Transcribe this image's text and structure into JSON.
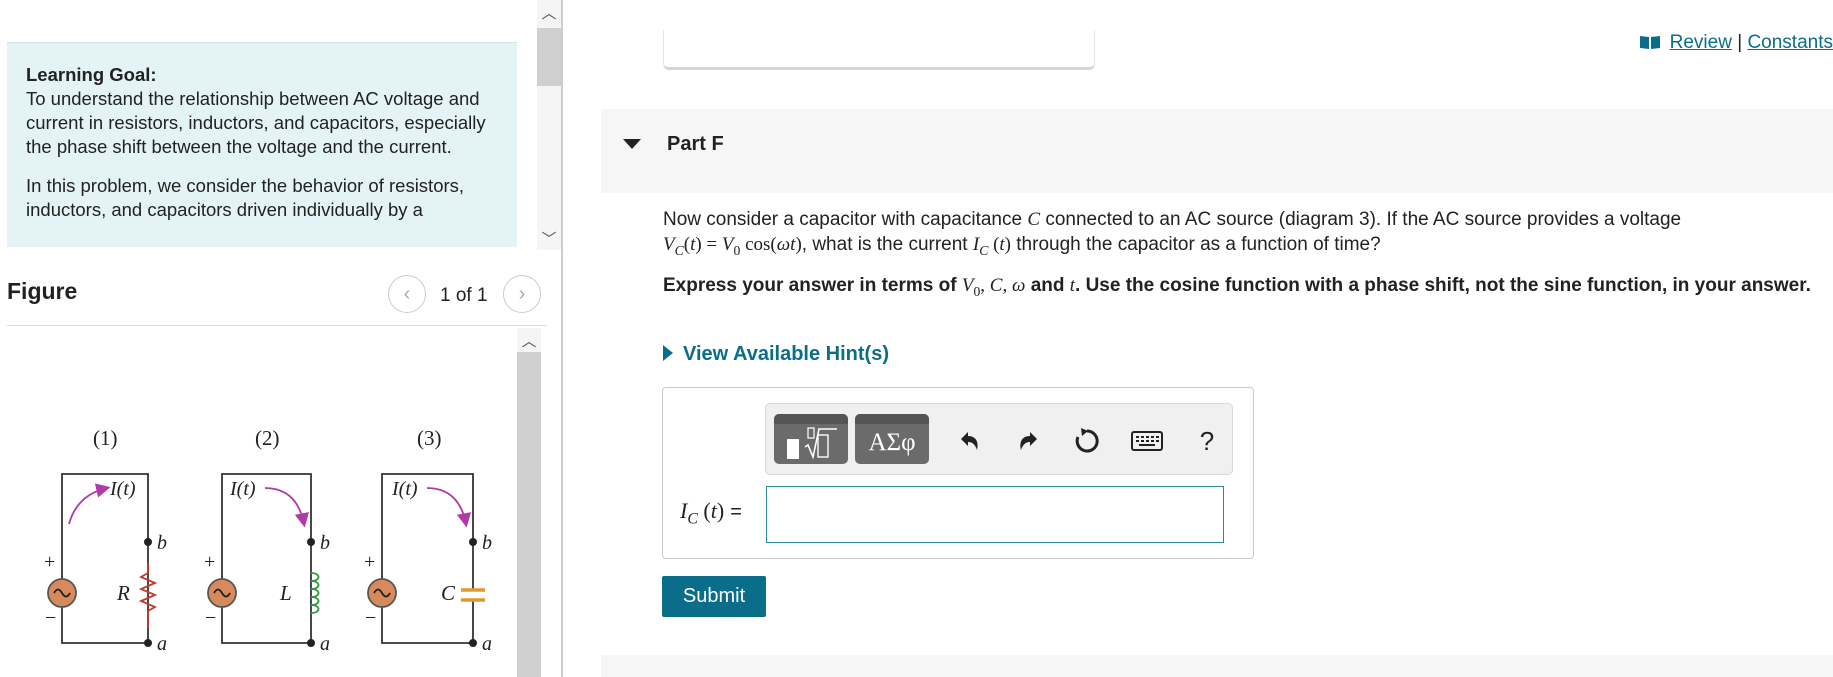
{
  "learning_goal": {
    "title": "Learning Goal:",
    "text": "To understand the relationship between AC voltage and current in resistors, inductors, and capacitors, especially the phase shift between the voltage and the current.",
    "intro": "In this problem, we consider the behavior of resistors, inductors, and capacitors driven individually by a"
  },
  "figure": {
    "title": "Figure",
    "page_indicator": "1 of 1",
    "circuits": [
      {
        "number": "(1)",
        "element_label": "R"
      },
      {
        "number": "(2)",
        "element_label": "L"
      },
      {
        "number": "(3)",
        "element_label": "C"
      }
    ],
    "current_label": "I(t)",
    "node_b": "b",
    "node_a": "a"
  },
  "links": {
    "review": "Review",
    "separator": "|",
    "constants": "Constants"
  },
  "part": {
    "title": "Part F"
  },
  "question": {
    "prefix": "Now consider a capacitor with capacitance",
    "after_c": "connected to an AC source (diagram 3). If the AC source provides a voltage",
    "after_v": ", what is the current",
    "suffix": "through the capacitor as a function of time?"
  },
  "instruction": {
    "prefix": "Express your answer in terms of",
    "and": "and",
    "suffix": ". Use the cosine function with a phase shift, not the sine function, in your answer."
  },
  "hints": {
    "label": "View Available Hint(s)"
  },
  "toolbar": {
    "symbols_label": "ΑΣφ",
    "help_label": "?"
  },
  "answer": {
    "equals": "=",
    "value": ""
  },
  "submit_label": "Submit",
  "colors": {
    "accent": "#0a6e8a",
    "goal_bg": "#e4f4f6",
    "current_arrow": "#b03aa8",
    "inductor": "#2e9b3c",
    "capacitor": "#e39a2c",
    "source": "#d98a5c"
  }
}
